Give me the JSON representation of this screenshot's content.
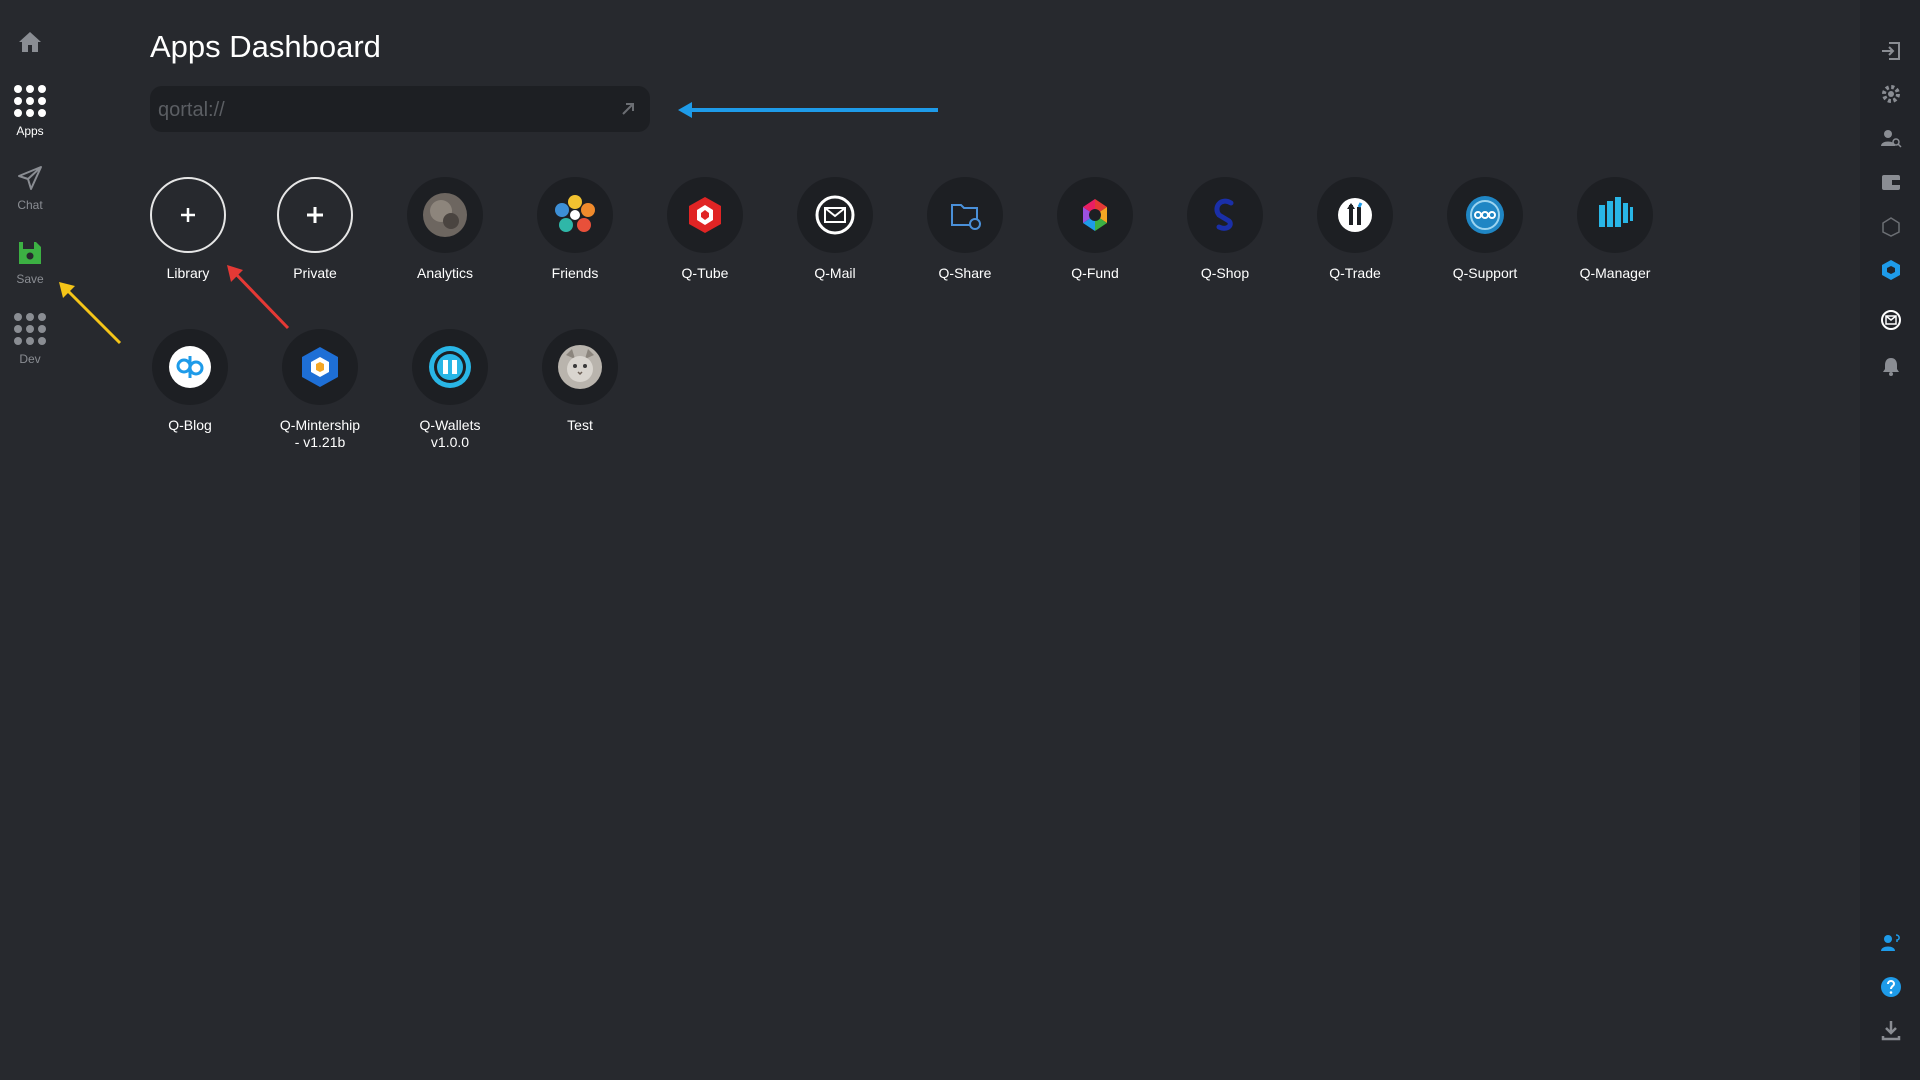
{
  "sidebar": {
    "items": [
      {
        "label": ""
      },
      {
        "label": "Apps"
      },
      {
        "label": "Chat"
      },
      {
        "label": "Save"
      },
      {
        "label": "Dev"
      }
    ]
  },
  "header": {
    "title": "Apps Dashboard"
  },
  "search": {
    "placeholder": "qortal://",
    "value": ""
  },
  "apps": [
    {
      "label": "Library",
      "icon": "plus-icon"
    },
    {
      "label": "Private",
      "icon": "plus-icon"
    },
    {
      "label": "Analytics",
      "icon": "analytics-avatar"
    },
    {
      "label": "Friends",
      "icon": "friends-icon"
    },
    {
      "label": "Q-Tube",
      "icon": "q-tube-icon"
    },
    {
      "label": "Q-Mail",
      "icon": "q-mail-icon"
    },
    {
      "label": "Q-Share",
      "icon": "q-share-icon"
    },
    {
      "label": "Q-Fund",
      "icon": "q-fund-icon"
    },
    {
      "label": "Q-Shop",
      "icon": "q-shop-icon"
    },
    {
      "label": "Q-Trade",
      "icon": "q-trade-icon"
    },
    {
      "label": "Q-Support",
      "icon": "q-support-icon"
    },
    {
      "label": "Q-Manager",
      "icon": "q-manager-icon"
    },
    {
      "label": "Q-Blog",
      "icon": "q-blog-icon"
    },
    {
      "label_line1": "Q-Mintership",
      "label_line2": "- v1.21b",
      "icon": "q-mintership-icon"
    },
    {
      "label_line1": "Q-Wallets",
      "label_line2": "v1.0.0",
      "icon": "q-wallets-icon"
    },
    {
      "label": "Test",
      "icon": "cat-avatar"
    }
  ],
  "colors": {
    "background": "#27292e",
    "sidebar_right": "#222429",
    "accent_blue": "#1e9be9",
    "save_green": "#3cb043",
    "annotation_yellow": "#f5c518",
    "annotation_red": "#e53935"
  }
}
